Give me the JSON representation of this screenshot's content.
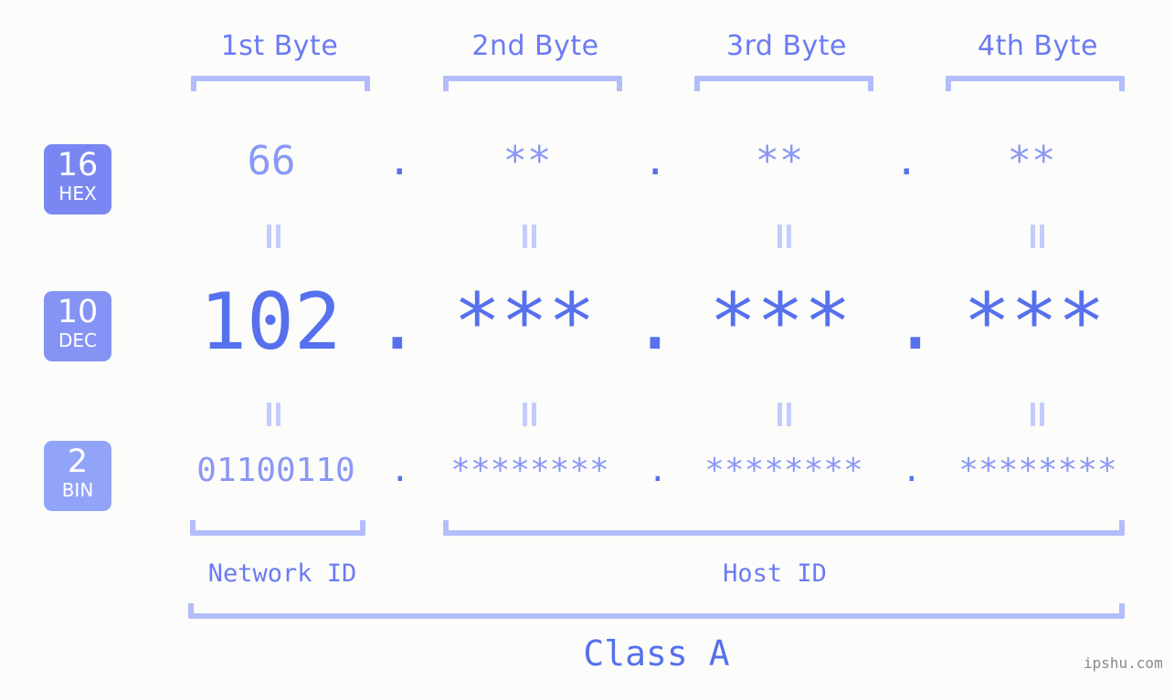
{
  "meta": {
    "background_color": "#fcfdfa",
    "accent_color": "#5670ee",
    "accent_light_color": "#8b97f7",
    "bracket_color": "#b3bdfb",
    "equals_color": "#c4ccfc",
    "watermark_color": "#8a8a8a"
  },
  "headers": {
    "byte1": "1st Byte",
    "byte2": "2nd Byte",
    "byte3": "3rd Byte",
    "byte4": "4th Byte"
  },
  "rows": [
    {
      "badge": {
        "base": "16",
        "name": "HEX",
        "color": "#7a87f2"
      },
      "values": [
        "66",
        "**",
        "**",
        "**"
      ],
      "separator": "."
    },
    {
      "badge": {
        "base": "10",
        "name": "DEC",
        "color": "#8593f5"
      },
      "values": [
        "102",
        "***",
        "***",
        "***"
      ],
      "separator": "."
    },
    {
      "badge": {
        "base": "2",
        "name": "BIN",
        "color": "#92a4f8"
      },
      "values": [
        "01100110",
        "********",
        "********",
        "********"
      ],
      "separator": "."
    }
  ],
  "equivalence_marks": {
    "glyph": "||",
    "count_per_row": 4,
    "rows": 2
  },
  "sections": {
    "network_id": "Network ID",
    "host_id": "Host ID",
    "class": "Class A"
  },
  "watermark": "ipshu.com"
}
